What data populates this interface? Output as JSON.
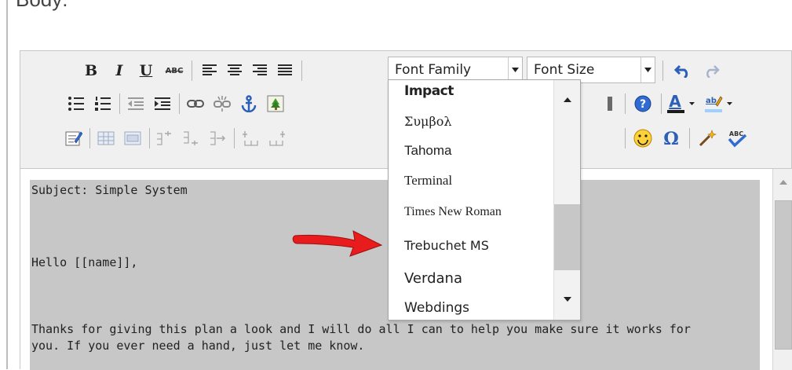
{
  "section": {
    "label": "Body:"
  },
  "toolbar": {
    "bold_label": "B",
    "italic_label": "I",
    "underline_label": "U",
    "strike_label": "ABC",
    "font_family": {
      "value": "Font Family"
    },
    "font_size": {
      "value": "Font Size"
    }
  },
  "font_dropdown": {
    "items": [
      {
        "label": "Impact"
      },
      {
        "label": "Συμβολ"
      },
      {
        "label": "Tahoma"
      },
      {
        "label": "Terminal"
      },
      {
        "label": "Times New Roman"
      },
      {
        "label": "Trebuchet MS"
      },
      {
        "label": "Verdana"
      },
      {
        "label": "Webdings"
      }
    ]
  },
  "editor": {
    "lines": [
      "Subject: Simple System",
      "Hello [[name]],",
      "Thanks for giving this plan a look and I will do all I can to help you make sure it works for",
      "you. If you ever need a hand, just let me know."
    ]
  },
  "icons": [
    "bold-icon",
    "italic-icon",
    "underline-icon",
    "strikethrough-icon",
    "align-left-icon",
    "align-center-icon",
    "align-right-icon",
    "justify-icon",
    "undo-icon",
    "redo-icon",
    "bullet-list-icon",
    "numbered-list-icon",
    "outdent-icon",
    "indent-icon",
    "link-icon",
    "unlink-icon",
    "anchor-icon",
    "image-icon",
    "help-icon",
    "text-color-icon",
    "highlight-color-icon",
    "edit-html-icon",
    "table-icon",
    "emoticon-icon",
    "special-char-icon",
    "cleanup-wand-icon",
    "spellcheck-icon"
  ],
  "colors": {
    "accent_red": "#e81c1c",
    "text_color_bar": "#1a1a1a",
    "highlight_bar": "#9ed0ff",
    "selection_gray": "#c7c7c7"
  }
}
